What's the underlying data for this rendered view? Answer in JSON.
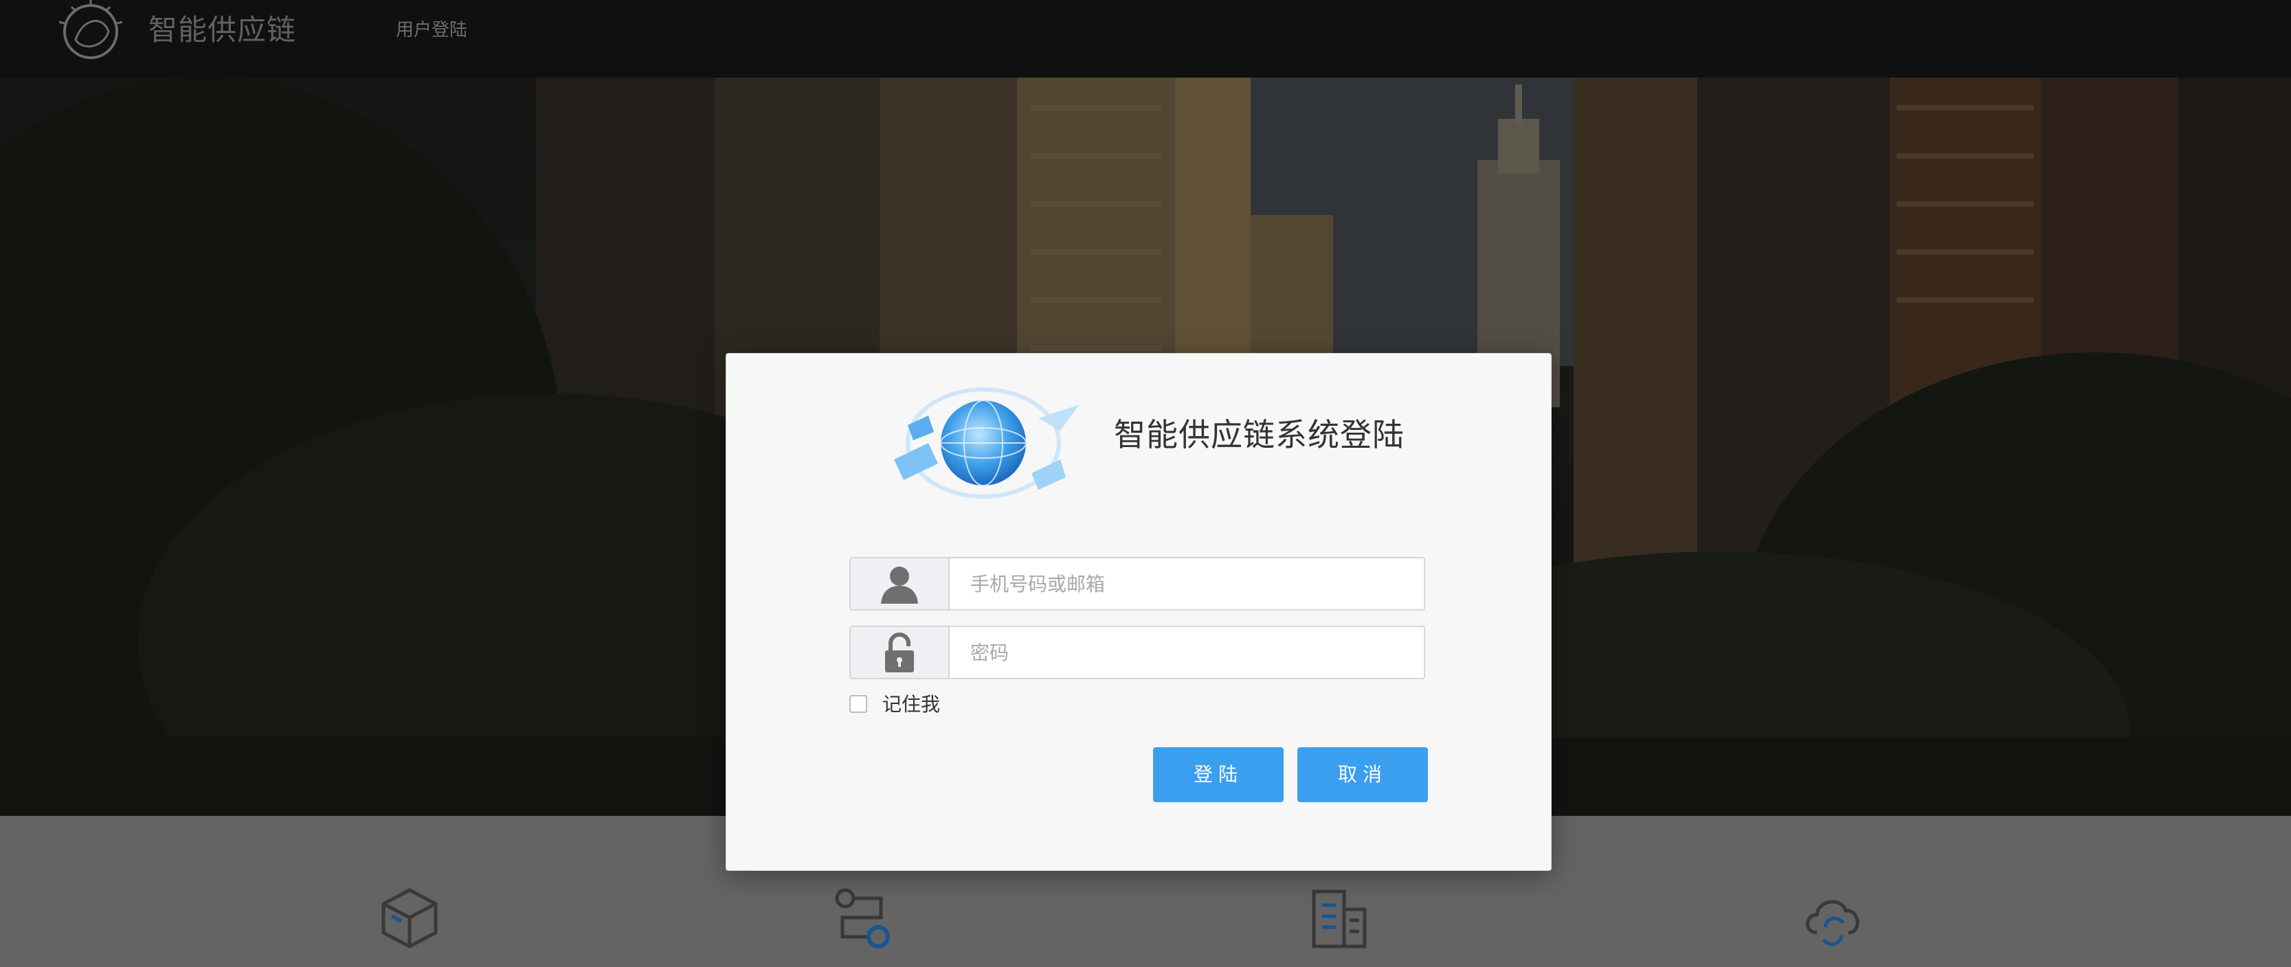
{
  "header": {
    "brand": "智能供应链",
    "nav_login": "用户登陆"
  },
  "login_modal": {
    "title": "智能供应链系统登陆",
    "username_placeholder": "手机号码或邮箱",
    "password_placeholder": "密码",
    "remember_label": "记住我",
    "remember_checked": false,
    "submit_label": "登陆",
    "cancel_label": "取消"
  },
  "icons": {
    "user": "user-icon",
    "lock": "lock-icon",
    "features": [
      "package-icon",
      "workflow-icon",
      "building-icon",
      "cloud-sync-icon"
    ]
  },
  "colors": {
    "topbar": "#151515",
    "primary_button": "#3b9ff0",
    "modal_bg": "#f7f7f7"
  }
}
